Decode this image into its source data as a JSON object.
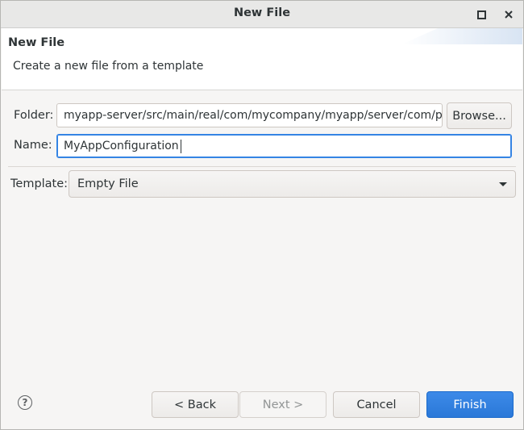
{
  "window": {
    "title": "New File"
  },
  "banner": {
    "title": "New File",
    "description": "Create a new file from a template"
  },
  "form": {
    "folder_label": "Folder:",
    "folder_value": "myapp-server/src/main/real/com/mycompany/myapp/server/com/par",
    "browse_label": "Browse...",
    "name_label": "Name:",
    "name_value": "MyAppConfiguration",
    "template_label": "Template:",
    "template_value": "Empty File"
  },
  "footer": {
    "help_glyph": "?",
    "back_label": "< Back",
    "next_label": "Next >",
    "cancel_label": "Cancel",
    "finish_label": "Finish"
  },
  "colors": {
    "accent": "#3584e4",
    "primary_button": "#2f80e0"
  },
  "icons": {
    "maximize": "maximize-icon",
    "close": "close-icon",
    "help": "help-icon",
    "dropdown": "chevron-down-icon"
  }
}
